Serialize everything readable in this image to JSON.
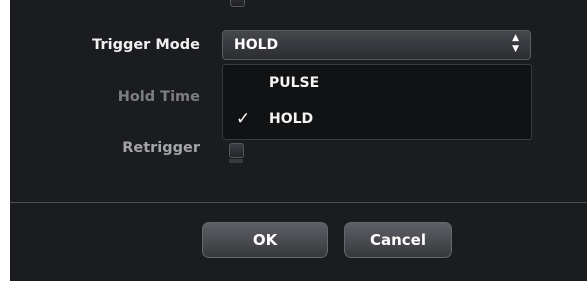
{
  "form": {
    "trigger_mode": {
      "label": "Trigger Mode",
      "value": "HOLD"
    },
    "hold_time": {
      "label": "Hold Time"
    },
    "retrigger": {
      "label": "Retrigger",
      "checked": false
    }
  },
  "dropdown": {
    "options": [
      "PULSE",
      "HOLD"
    ],
    "selected": "HOLD",
    "check_glyph": "✓"
  },
  "buttons": {
    "ok": "OK",
    "cancel": "Cancel"
  },
  "icons": {
    "select_arrows": "up-down-arrows-icon",
    "checkmark": "checkmark-icon"
  },
  "colors": {
    "background": "#1b1c1f",
    "dropdown_bg": "#111214",
    "text": "#ffffff"
  }
}
